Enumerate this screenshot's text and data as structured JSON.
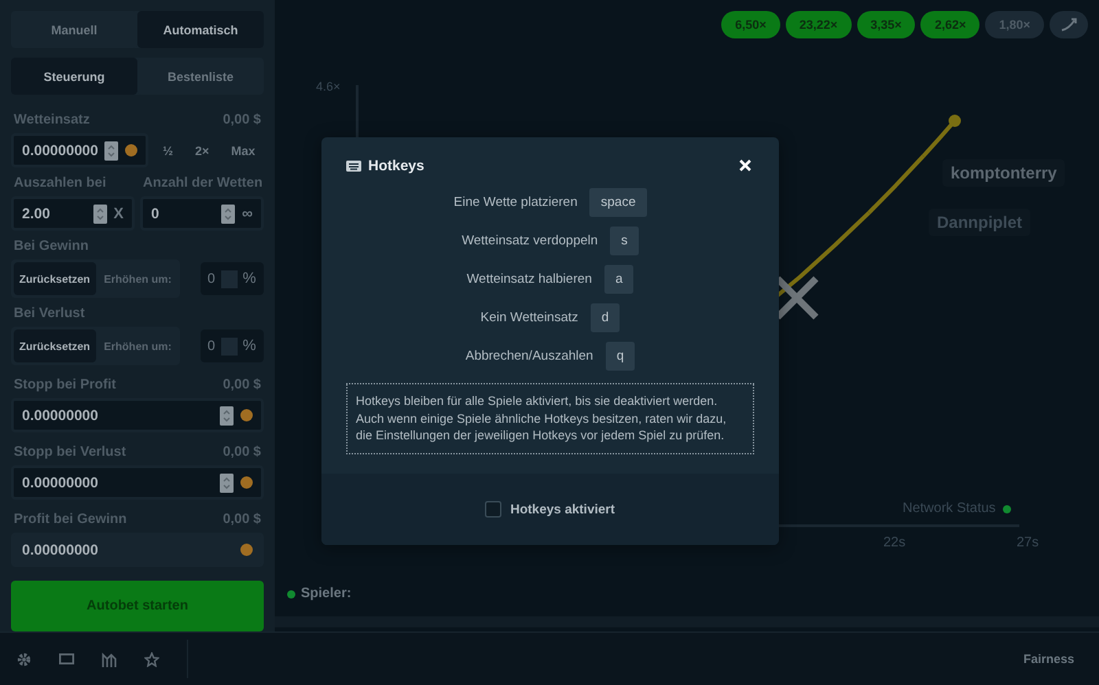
{
  "sidebar": {
    "mode_tabs": [
      {
        "label": "Manuell",
        "selected": false
      },
      {
        "label": "Automatisch",
        "selected": true
      }
    ],
    "view_tabs": [
      {
        "label": "Steuerung",
        "selected": true
      },
      {
        "label": "Bestenliste",
        "selected": false
      }
    ],
    "bet": {
      "label": "Wetteinsatz",
      "amount": "0,00 $",
      "value": "0.00000000",
      "buttons": [
        "½",
        "2×",
        "Max"
      ]
    },
    "cashout": {
      "label": "Auszahlen bei",
      "value": "2.00",
      "suffix": "X"
    },
    "bet_count": {
      "label": "Anzahl der Wetten",
      "value": "0",
      "suffix": "∞"
    },
    "on_win": {
      "label": "Bei Gewinn",
      "options": [
        {
          "label": "Zurücksetzen",
          "selected": true
        },
        {
          "label": "Erhöhen um:",
          "selected": false
        }
      ],
      "value": "0",
      "suffix": "%"
    },
    "on_loss": {
      "label": "Bei Verlust",
      "options": [
        {
          "label": "Zurücksetzen",
          "selected": true
        },
        {
          "label": "Erhöhen um:",
          "selected": false
        }
      ],
      "value": "0",
      "suffix": "%"
    },
    "stop_fields": [
      {
        "label": "Stopp bei Profit",
        "amount": "0,00 $",
        "value": "0.00000000",
        "disabled": false
      },
      {
        "label": "Stopp bei Verlust",
        "amount": "0,00 $",
        "value": "0.00000000",
        "disabled": false
      },
      {
        "label": "Profit bei Gewinn",
        "amount": "0,00 $",
        "value": "0.00000000",
        "disabled": true
      }
    ],
    "start_button": "Autobet starten"
  },
  "history": [
    {
      "label": "6,50×",
      "color": "#0a7a16"
    },
    {
      "label": "23,22×",
      "color": "#0a7a16"
    },
    {
      "label": "3,35×",
      "color": "#0a7a16"
    },
    {
      "label": "2,62×",
      "color": "#0a7a16"
    },
    {
      "label": "1,80×",
      "color": "#1c2a35"
    }
  ],
  "graph": {
    "y_tick": "4.6×",
    "x_ticks": [
      "22s",
      "27s"
    ],
    "players": [
      "komptonterry",
      "Dannpiplet"
    ],
    "network_status": "Network Status"
  },
  "players_label": "Spieler:",
  "footer": {
    "link": "Fairness"
  },
  "modal": {
    "title": "Hotkeys",
    "rows": [
      {
        "action": "Eine Wette platzieren",
        "key": "space"
      },
      {
        "action": "Wetteinsatz verdoppeln",
        "key": "s"
      },
      {
        "action": "Wetteinsatz halbieren",
        "key": "a"
      },
      {
        "action": "Kein Wetteinsatz",
        "key": "d"
      },
      {
        "action": "Abbrechen/Auszahlen",
        "key": "q"
      }
    ],
    "note": "Hotkeys bleiben für alle Spiele aktiviert, bis sie deaktiviert werden. Auch wenn einige Spiele ähnliche Hotkeys besitzen, raten wir dazu, die Einstellungen der jeweiligen Hotkeys vor jedem Spiel zu prüfen.",
    "checkbox": {
      "label": "Hotkeys aktiviert",
      "checked": false
    }
  }
}
